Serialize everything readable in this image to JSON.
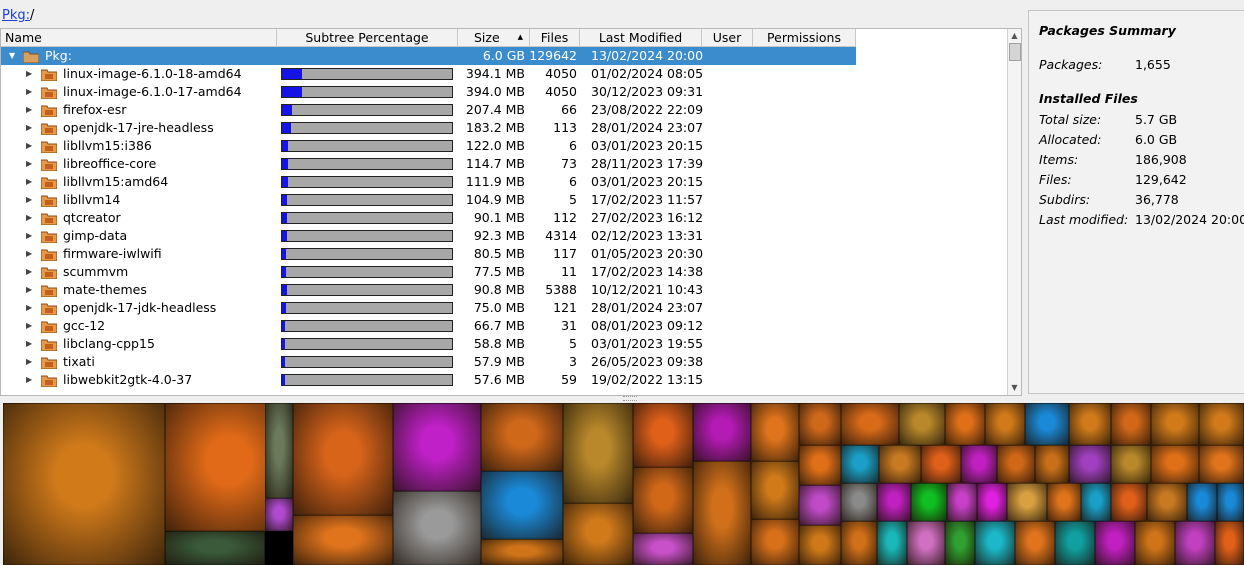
{
  "breadcrumb": {
    "link": "Pkg:",
    "suffix": "/"
  },
  "columns": {
    "name": "Name",
    "subtree": "Subtree Percentage",
    "size": "Size",
    "files": "Files",
    "modified": "Last Modified",
    "user": "User",
    "permissions": "Permissions"
  },
  "root": {
    "name": "Pkg:",
    "size": "6.0 GB",
    "files": "129642",
    "modified": "13/02/2024 20:00"
  },
  "rows": [
    {
      "name": "linux-image-6.1.0-18-amd64",
      "pct": 6.4,
      "size": "394.1 MB",
      "files": "4050",
      "modified": "01/02/2024 08:05"
    },
    {
      "name": "linux-image-6.1.0-17-amd64",
      "pct": 6.4,
      "size": "394.0 MB",
      "files": "4050",
      "modified": "30/12/2023 09:31"
    },
    {
      "name": "firefox-esr",
      "pct": 3.4,
      "size": "207.4 MB",
      "files": "66",
      "modified": "23/08/2022 22:09"
    },
    {
      "name": "openjdk-17-jre-headless",
      "pct": 3.0,
      "size": "183.2 MB",
      "files": "113",
      "modified": "28/01/2024 23:07"
    },
    {
      "name": "libllvm15:i386",
      "pct": 2.0,
      "size": "122.0 MB",
      "files": "6",
      "modified": "03/01/2023 20:15"
    },
    {
      "name": "libreoffice-core",
      "pct": 1.9,
      "size": "114.7 MB",
      "files": "73",
      "modified": "28/11/2023 17:39"
    },
    {
      "name": "libllvm15:amd64",
      "pct": 1.8,
      "size": "111.9 MB",
      "files": "6",
      "modified": "03/01/2023 20:15"
    },
    {
      "name": "libllvm14",
      "pct": 1.7,
      "size": "104.9 MB",
      "files": "5",
      "modified": "17/02/2023 11:57"
    },
    {
      "name": "qtcreator",
      "pct": 1.5,
      "size": "90.1 MB",
      "files": "112",
      "modified": "27/02/2023 16:12"
    },
    {
      "name": "gimp-data",
      "pct": 1.5,
      "size": "92.3 MB",
      "files": "4314",
      "modified": "02/12/2023 13:31"
    },
    {
      "name": "firmware-iwlwifi",
      "pct": 1.3,
      "size": "80.5 MB",
      "files": "117",
      "modified": "01/05/2023 20:30"
    },
    {
      "name": "scummvm",
      "pct": 1.3,
      "size": "77.5 MB",
      "files": "11",
      "modified": "17/02/2023 14:38"
    },
    {
      "name": "mate-themes",
      "pct": 1.5,
      "size": "90.8 MB",
      "files": "5388",
      "modified": "10/12/2021 10:43"
    },
    {
      "name": "openjdk-17-jdk-headless",
      "pct": 1.2,
      "size": "75.0 MB",
      "files": "121",
      "modified": "28/01/2024 23:07"
    },
    {
      "name": "gcc-12",
      "pct": 1.1,
      "size": "66.7 MB",
      "files": "31",
      "modified": "08/01/2023 09:12"
    },
    {
      "name": "libclang-cpp15",
      "pct": 1.0,
      "size": "58.8 MB",
      "files": "5",
      "modified": "03/01/2023 19:55"
    },
    {
      "name": "tixati",
      "pct": 0.9,
      "size": "57.9 MB",
      "files": "3",
      "modified": "26/05/2023 09:38"
    },
    {
      "name": "libwebkit2gtk-4.0-37",
      "pct": 0.9,
      "size": "57.6 MB",
      "files": "59",
      "modified": "19/02/2022 13:15"
    }
  ],
  "summary": {
    "title": "Packages Summary",
    "packages_label": "Packages:",
    "packages_value": "1,655",
    "installed_title": "Installed Files",
    "fields": [
      {
        "label": "Total size:",
        "value": "5.7 GB"
      },
      {
        "label": "Allocated:",
        "value": "6.0 GB"
      },
      {
        "label": "Items:",
        "value": "186,908"
      },
      {
        "label": "Files:",
        "value": "129,642"
      },
      {
        "label": "Subdirs:",
        "value": "36,778"
      },
      {
        "label": "Last modified:",
        "value": "13/02/2024 20:00"
      }
    ]
  },
  "colors": {
    "selection": "#3a8ccc",
    "bar_fill": "#1414e6",
    "bar_bg": "#a8a8a8",
    "link": "#1a3fd8"
  }
}
